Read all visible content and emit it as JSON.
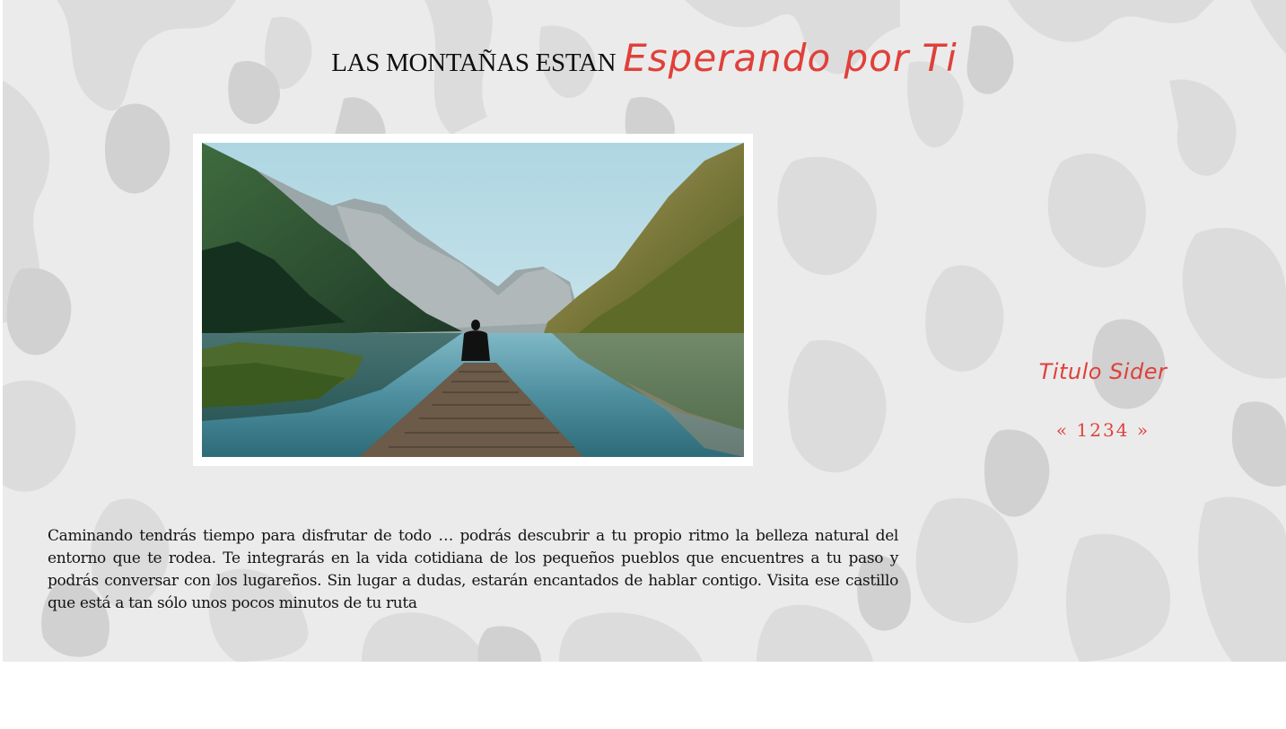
{
  "header": {
    "title_plain": "LAS MONTAÑAS ESTAN",
    "title_script": "Esperando por Ti"
  },
  "hero_image": {
    "alt": "Persona sentada en un muelle frente a un lago entre montañas"
  },
  "sidebar": {
    "title": "Titulo Sider",
    "pagination": {
      "prev": "«",
      "pages": [
        "1",
        "2",
        "3",
        "4"
      ],
      "next": "»"
    }
  },
  "content": {
    "paragraph": "Caminando tendrás tiempo para disfrutar de todo … podrás descubrir a tu propio ritmo la belleza natural del entorno que te rodea. Te integrarás en la vida cotidiana de los pequeños pueblos que encuentres a tu paso y podrás conversar con los lugareños. Sin lugar a dudas, estarán encantados de hablar contigo. Visita ese castillo que está a tan sólo unos pocos minutos de tu ruta"
  },
  "colors": {
    "accent": "#e0403a",
    "background": "#ebebeb",
    "camo_light": "#dedede",
    "camo_dark": "#d3d3d3"
  }
}
